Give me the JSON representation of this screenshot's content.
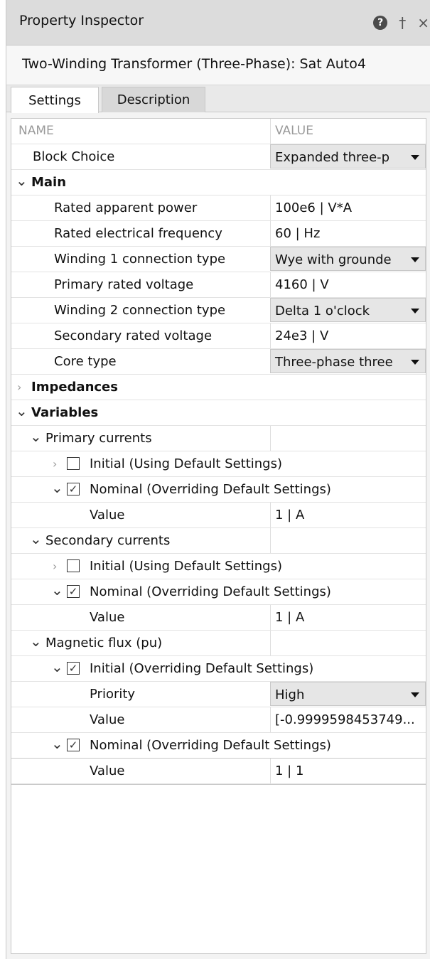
{
  "panel": {
    "title": "Property Inspector",
    "icons": {
      "help": "?",
      "pin": "†",
      "close": "×"
    }
  },
  "block": {
    "title": "Two-Winding Transformer (Three-Phase): Sat Auto4"
  },
  "tabs": [
    {
      "label": "Settings",
      "active": true
    },
    {
      "label": "Description",
      "active": false
    }
  ],
  "grid": {
    "header": {
      "name": "NAME",
      "value": "VALUE"
    },
    "block_choice": {
      "name": "Block Choice",
      "value": "Expanded three-p"
    },
    "main": {
      "label": "Main",
      "rows": [
        {
          "name": "Rated apparent power",
          "value": "100e6 | V*A"
        },
        {
          "name": "Rated electrical frequency",
          "value": "60 | Hz"
        },
        {
          "name": "Winding 1 connection type",
          "value": "Wye with grounde"
        },
        {
          "name": "Primary rated voltage",
          "value": "4160 | V"
        },
        {
          "name": "Winding 2 connection type",
          "value": "Delta 1 o'clock"
        },
        {
          "name": "Secondary rated voltage",
          "value": "24e3 | V"
        },
        {
          "name": "Core type",
          "value": "Three-phase three"
        }
      ]
    },
    "impedances": {
      "label": "Impedances"
    },
    "variables": {
      "label": "Variables",
      "primary": {
        "label": "Primary currents",
        "initial": "Initial (Using Default Settings)",
        "nominal": "Nominal (Overriding Default Settings)",
        "value_label": "Value",
        "value": "1 | A"
      },
      "secondary": {
        "label": "Secondary currents",
        "initial": "Initial (Using Default Settings)",
        "nominal": "Nominal (Overriding Default Settings)",
        "value_label": "Value",
        "value": "1 | A"
      },
      "flux": {
        "label": "Magnetic flux (pu)",
        "initial": "Initial (Overriding Default Settings)",
        "priority_label": "Priority",
        "priority": "High",
        "initial_value_label": "Value",
        "initial_value": "[-0.9999598453749...",
        "nominal": "Nominal (Overriding Default Settings)",
        "nominal_value_label": "Value",
        "nominal_value": "1 | 1"
      }
    }
  }
}
